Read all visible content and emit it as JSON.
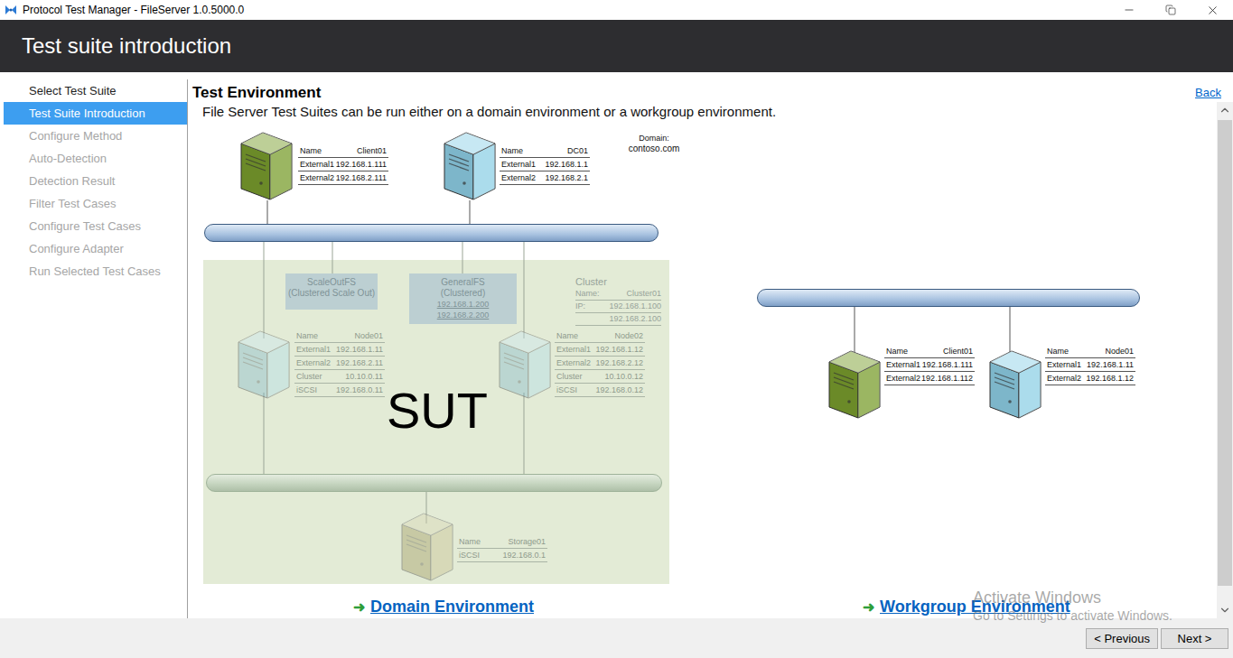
{
  "window": {
    "title": "Protocol Test Manager - FileServer 1.0.5000.0"
  },
  "header": {
    "title": "Test suite introduction"
  },
  "sidebar": {
    "items": [
      {
        "label": "Select Test Suite",
        "selected": false,
        "disabled": false
      },
      {
        "label": "Test Suite Introduction",
        "selected": true,
        "disabled": false
      },
      {
        "label": "Configure Method",
        "selected": false,
        "disabled": true
      },
      {
        "label": "Auto-Detection",
        "selected": false,
        "disabled": true
      },
      {
        "label": "Detection Result",
        "selected": false,
        "disabled": true
      },
      {
        "label": "Filter Test Cases",
        "selected": false,
        "disabled": true
      },
      {
        "label": "Configure Test Cases",
        "selected": false,
        "disabled": true
      },
      {
        "label": "Configure Adapter",
        "selected": false,
        "disabled": true
      },
      {
        "label": "Run Selected Test Cases",
        "selected": false,
        "disabled": true
      }
    ]
  },
  "content": {
    "heading": "Test Environment",
    "back": "Back",
    "description": "File Server Test Suites can be run either on a domain environment or a workgroup environment."
  },
  "diagram": {
    "domain": {
      "label": "Domain:",
      "value": "contoso.com"
    },
    "servers": [
      {
        "color": "#7a9e2e",
        "faded": false,
        "rows": [
          {
            "label": "Name",
            "value": "Client01"
          },
          {
            "label": "External1",
            "value": "192.168.1.111"
          },
          {
            "label": "External2",
            "value": "192.168.2.111"
          }
        ]
      },
      {
        "color": "#8fd0e6",
        "faded": false,
        "rows": [
          {
            "label": "Name",
            "value": "DC01"
          },
          {
            "label": "External1",
            "value": "192.168.1.1"
          },
          {
            "label": "External2",
            "value": "192.168.2.1"
          }
        ]
      },
      {
        "color": "#8fd0e6",
        "faded": true,
        "rows": [
          {
            "label": "Name",
            "value": "Node01"
          },
          {
            "label": "External1",
            "value": "192.168.1.11"
          },
          {
            "label": "External2",
            "value": "192.168.2.11"
          },
          {
            "label": "Cluster",
            "value": "10.10.0.11"
          },
          {
            "label": "iSCSI",
            "value": "192.168.0.11"
          }
        ]
      },
      {
        "color": "#8fd0e6",
        "faded": true,
        "rows": [
          {
            "label": "Name",
            "value": "Node02"
          },
          {
            "label": "External1",
            "value": "192.168.1.12"
          },
          {
            "label": "External2",
            "value": "192.168.2.12"
          },
          {
            "label": "Cluster",
            "value": "10.10.0.12"
          },
          {
            "label": "iSCSI",
            "value": "192.168.0.12"
          }
        ]
      },
      {
        "color": "#b0a860",
        "faded": true,
        "rows": [
          {
            "label": "Name",
            "value": "Storage01"
          },
          {
            "label": "iSCSI",
            "value": "192.168.0.1"
          }
        ]
      },
      {
        "color": "#7a9e2e",
        "faded": false,
        "rows": [
          {
            "label": "Name",
            "value": "Client01"
          },
          {
            "label": "External1",
            "value": "192.168.1.111"
          },
          {
            "label": "External2",
            "value": "192.168.1.112"
          }
        ]
      },
      {
        "color": "#8fd0e6",
        "faded": false,
        "rows": [
          {
            "label": "Name",
            "value": "Node01"
          },
          {
            "label": "External1",
            "value": "192.168.1.11"
          },
          {
            "label": "External2",
            "value": "192.168.1.12"
          }
        ]
      }
    ],
    "roles": [
      {
        "title": "ScaleOutFS",
        "subtitle": "(Clustered Scale Out)",
        "ips": []
      },
      {
        "title": "GeneralFS",
        "subtitle": "(Clustered)",
        "ips": [
          "192.168.1.200",
          "192.168.2.200"
        ]
      }
    ],
    "cluster": {
      "title": "Cluster",
      "rows": [
        {
          "label": "Name:",
          "value": "Cluster01"
        },
        {
          "label": "IP:",
          "value": "192.168.1.100"
        },
        {
          "label": "",
          "value": "192.168.2.100"
        }
      ]
    },
    "sut_label": "SUT"
  },
  "links": [
    {
      "icon": "➜",
      "label": "Domain Environment"
    },
    {
      "icon": "➜",
      "label": "Workgroup Environment"
    }
  ],
  "scrollbar": {
    "level": 0.97
  },
  "buttons": [
    {
      "label": "< Previous"
    },
    {
      "label": "Next >"
    }
  ],
  "watermark": {
    "title": "Activate Windows",
    "subtitle": "Go to Settings to activate Windows."
  }
}
